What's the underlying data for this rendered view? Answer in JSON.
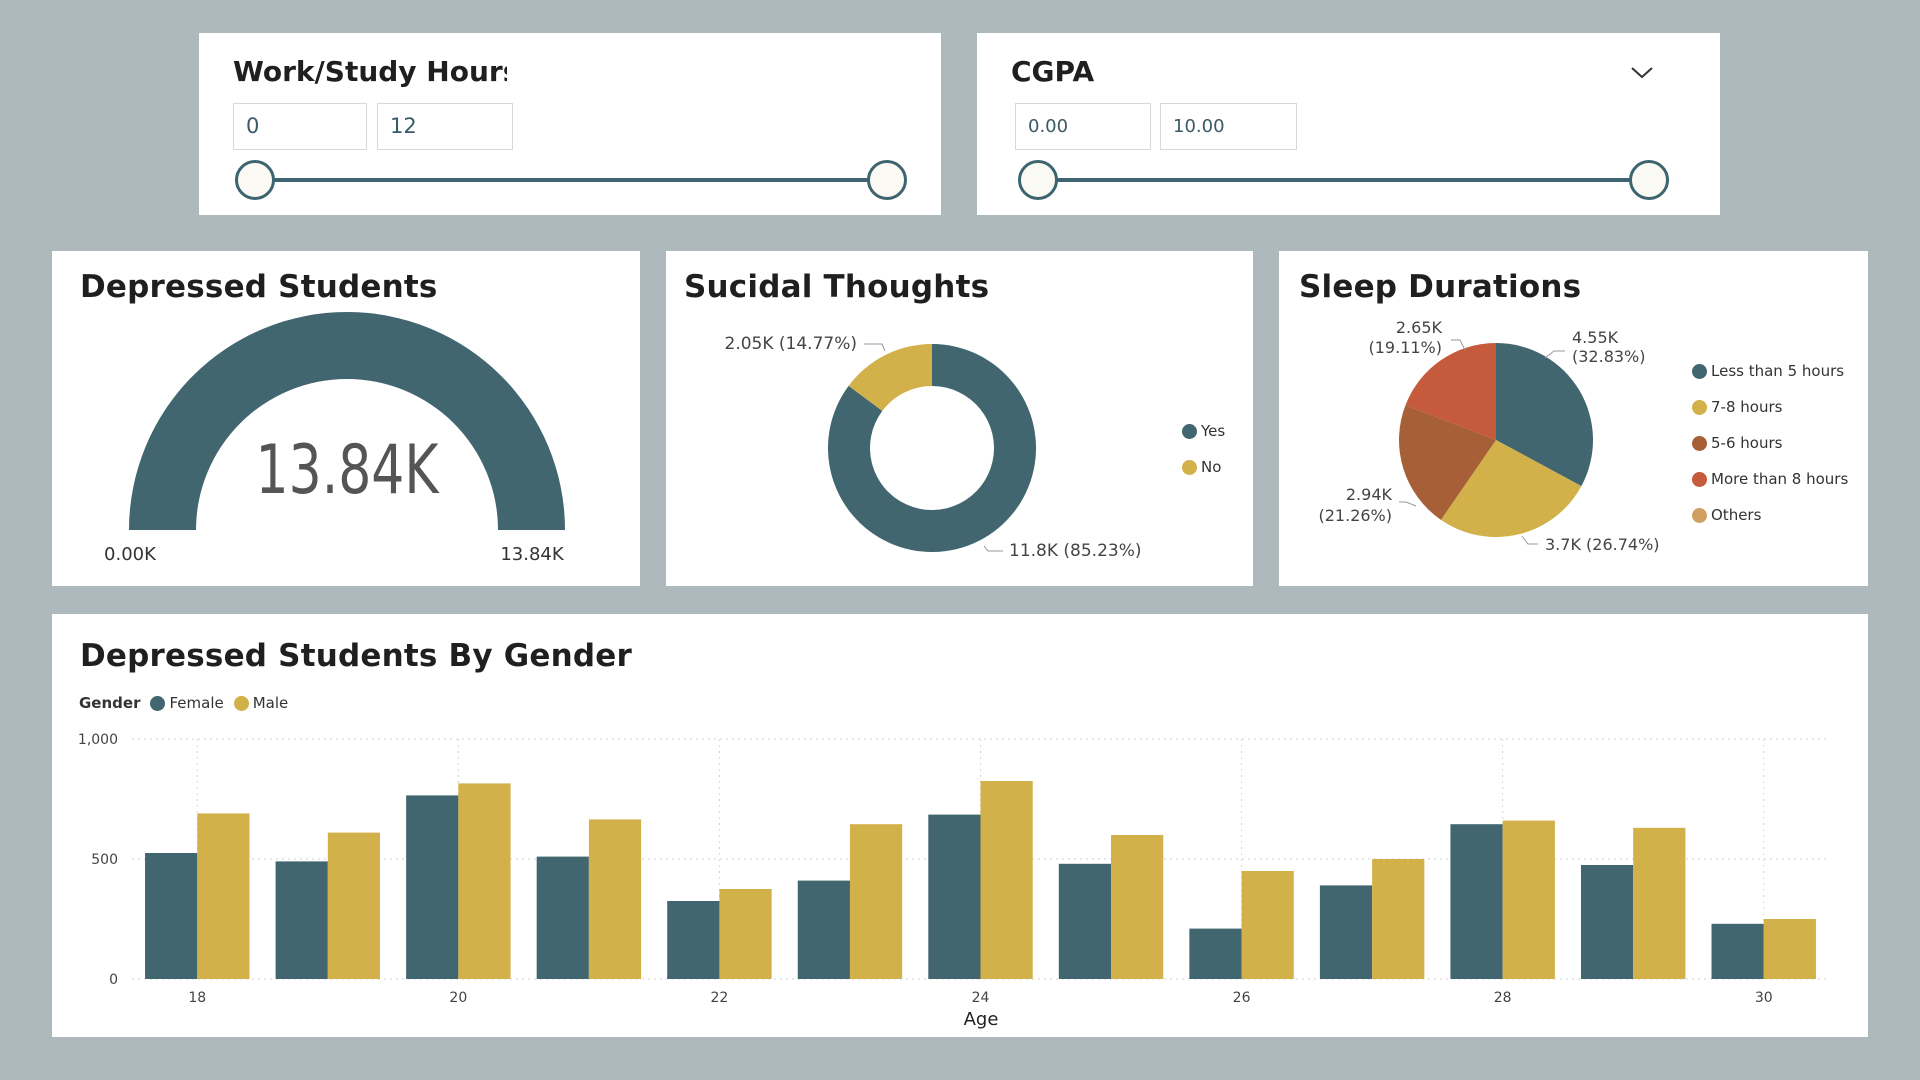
{
  "colors": {
    "teal": "#41666f",
    "gold": "#d2b04a",
    "brown": "#a75f37",
    "orange": "#c65a3c",
    "tan": "#cfa061",
    "background": "#adb9bd"
  },
  "slicers": {
    "work": {
      "title": "Work/Study Hours",
      "min": "0",
      "max": "12"
    },
    "cgpa": {
      "title": "CGPA",
      "min": "0.00",
      "max": "10.00",
      "icon": "chevron-down-icon"
    }
  },
  "gauge": {
    "title": "Depressed Students",
    "value_label": "13.84K",
    "min_label": "0.00K",
    "max_label": "13.84K",
    "value": 13.84,
    "max": 13.84
  },
  "suicidal": {
    "title": "Sucidal Thoughts",
    "label_yes": "11.8K (85.23%)",
    "label_no": "2.05K (14.77%)",
    "legend": [
      "Yes",
      "No"
    ]
  },
  "sleep": {
    "title": "Sleep Durations",
    "labels": {
      "less5_a": "4.55K",
      "less5_b": "(32.83%)",
      "s78": "3.7K (26.74%)",
      "s56_a": "2.94K",
      "s56_b": "(21.26%)",
      "more8_a": "2.65K",
      "more8_b": "(19.11%)"
    },
    "legend": [
      "Less than 5 hours",
      "7-8 hours",
      "5-6 hours",
      "More than 8 hours",
      "Others"
    ]
  },
  "gender_chart": {
    "title": "Depressed Students By Gender",
    "legend_title": "Gender",
    "legend": [
      "Female",
      "Male"
    ],
    "xlabel": "Age"
  },
  "chart_data": [
    {
      "type": "gauge",
      "title": "Depressed Students",
      "value": 13.84,
      "min": 0,
      "max": 13.84,
      "unit": "K"
    },
    {
      "type": "pie",
      "title": "Sucidal Thoughts",
      "donut": true,
      "categories": [
        "Yes",
        "No"
      ],
      "values": [
        11.8,
        2.05
      ],
      "percentages": [
        85.23,
        14.77
      ],
      "unit": "K"
    },
    {
      "type": "pie",
      "title": "Sleep Durations",
      "categories": [
        "Less than 5 hours",
        "7-8 hours",
        "5-6 hours",
        "More than 8 hours",
        "Others"
      ],
      "values": [
        4.55,
        3.7,
        2.94,
        2.65,
        0
      ],
      "percentages": [
        32.83,
        26.74,
        21.26,
        19.11,
        0
      ],
      "unit": "K"
    },
    {
      "type": "bar",
      "title": "Depressed Students By Gender",
      "xlabel": "Age",
      "ylabel": "",
      "x": [
        18,
        19,
        20,
        21,
        22,
        23,
        24,
        25,
        26,
        27,
        28,
        29,
        30
      ],
      "tick_labels_x": [
        "18",
        "20",
        "22",
        "24",
        "26",
        "28",
        "30"
      ],
      "tick_labels_y": [
        "0",
        "500",
        "1,000"
      ],
      "ylim": [
        0,
        1000
      ],
      "series": [
        {
          "name": "Female",
          "values": [
            525,
            490,
            765,
            510,
            325,
            410,
            685,
            480,
            210,
            390,
            645,
            475,
            230
          ]
        },
        {
          "name": "Male",
          "values": [
            690,
            610,
            815,
            665,
            375,
            645,
            825,
            600,
            450,
            500,
            660,
            630,
            250
          ]
        }
      ],
      "legend_position": "top-left",
      "grid": true
    }
  ]
}
